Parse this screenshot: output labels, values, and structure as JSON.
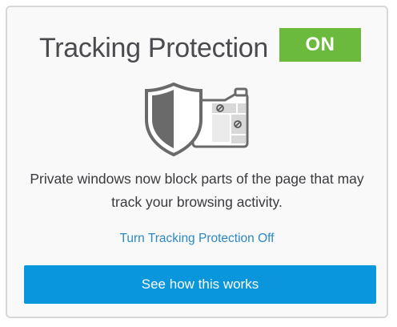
{
  "panel": {
    "title": "Tracking Protection",
    "status_badge": "ON",
    "description": "Private windows now block parts of the page that may track your browsing activity.",
    "toggle_link": "Turn Tracking Protection Off",
    "learn_button": "See how this works"
  },
  "icons": {
    "illustration": "shield-blocking-trackers-icon"
  },
  "colors": {
    "badge_green": "#6cba3d",
    "button_blue": "#0996dd",
    "link_blue": "#2b88c6",
    "title_gray": "#4a4a4f",
    "card_border": "#d8d8d8",
    "card_background": "#f9f9f9"
  }
}
